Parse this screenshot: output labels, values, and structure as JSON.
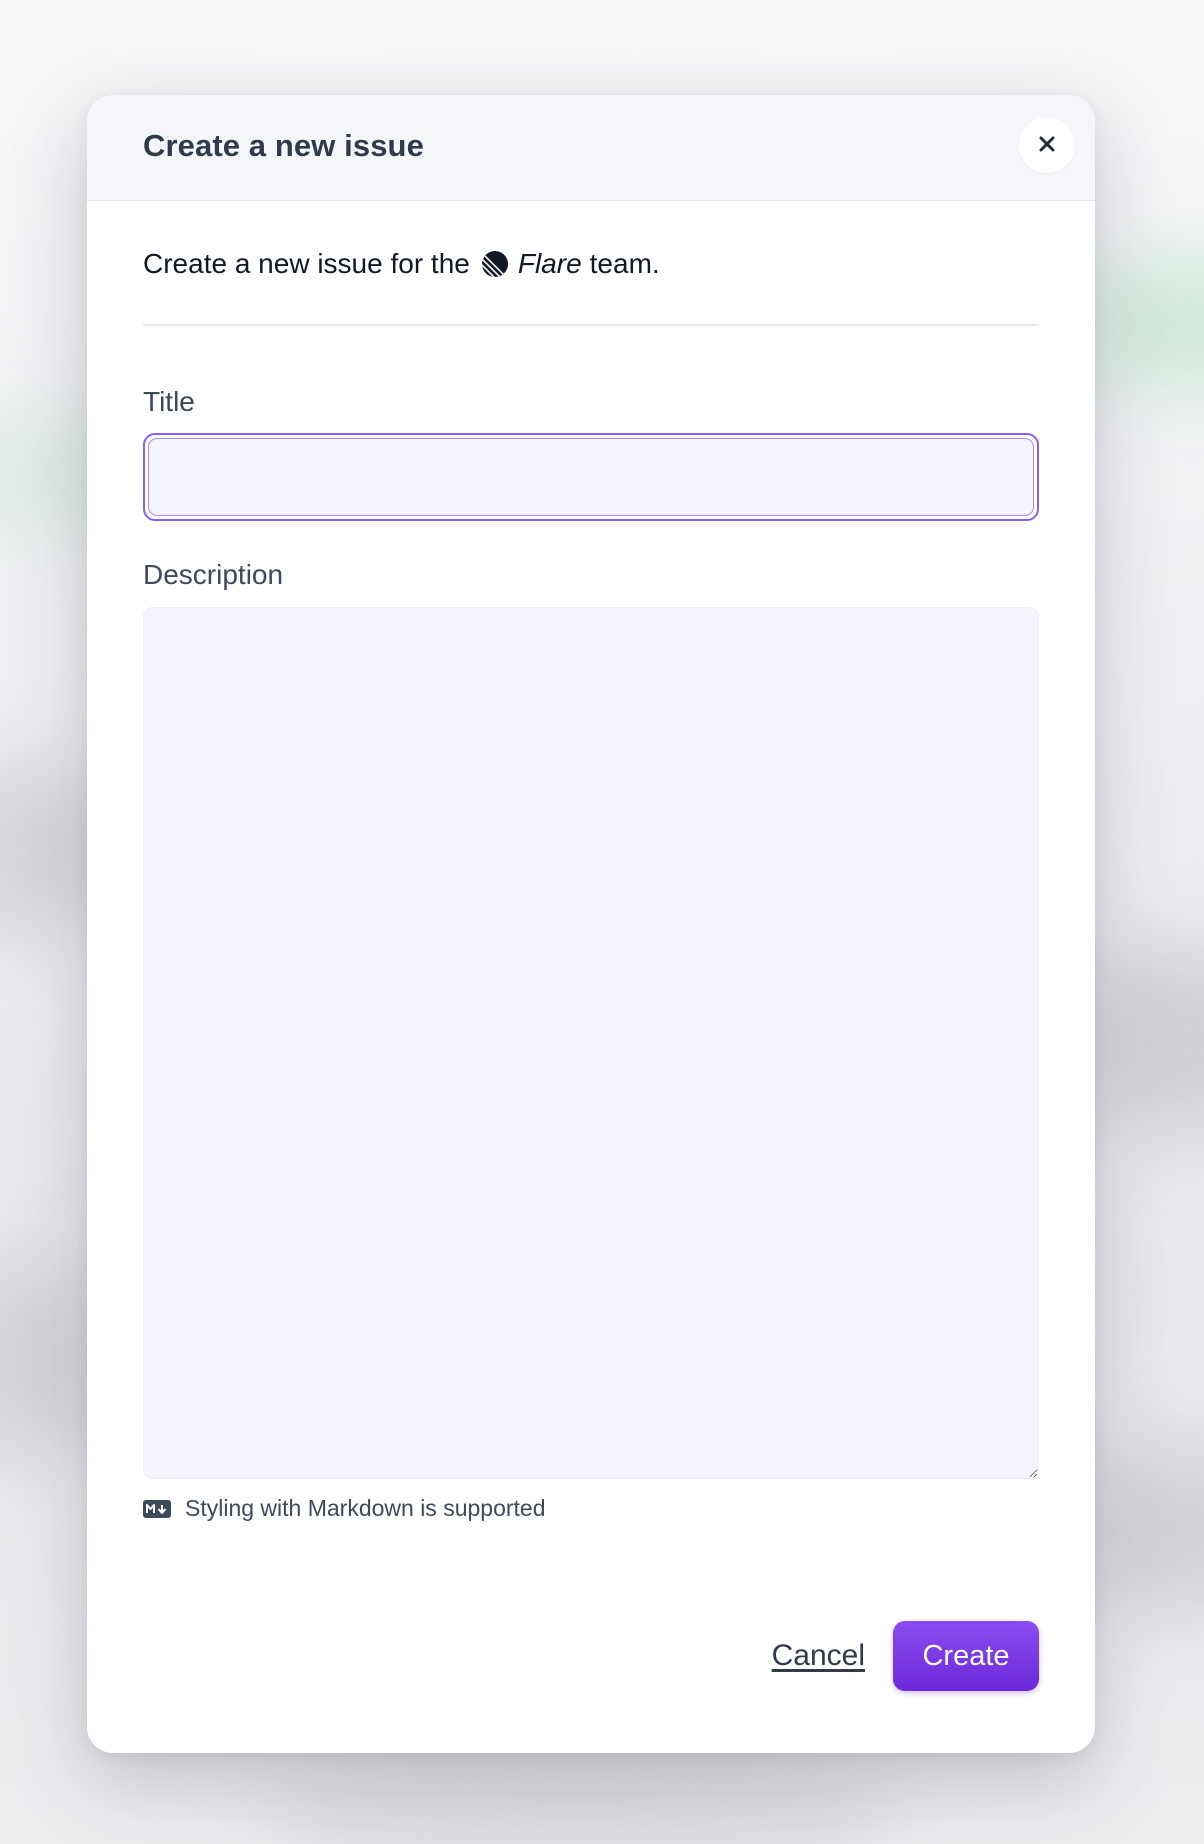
{
  "modal": {
    "title": "Create a new issue",
    "close_icon": "close-icon",
    "intro_prefix": "Create a new issue for the",
    "team_logo_icon": "flare-logo-icon",
    "team_name": "Flare",
    "intro_suffix": "team."
  },
  "form": {
    "title_label": "Title",
    "title_value": "",
    "description_label": "Description",
    "description_value": "",
    "markdown_icon": "markdown-icon",
    "markdown_hint": "Styling with Markdown is supported"
  },
  "actions": {
    "cancel_label": "Cancel",
    "create_label": "Create"
  },
  "colors": {
    "accent": "#7c3aed",
    "focus_ring": "#8b5cf6",
    "heading": "#2f3a4c"
  }
}
